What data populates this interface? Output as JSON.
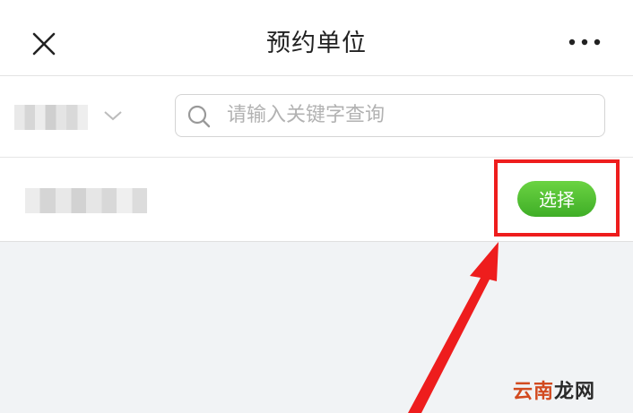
{
  "header": {
    "title": "预约单位",
    "close_icon": "close-icon",
    "more_icon": "more-icon"
  },
  "toolbar": {
    "filter_value": "",
    "filter_icon": "chevron-down-icon",
    "search": {
      "placeholder": "请输入关键字查询",
      "value": "",
      "icon": "search-icon"
    }
  },
  "list": {
    "items": [
      {
        "name": "",
        "action_label": "选择"
      }
    ]
  },
  "annotation": {
    "highlight_color": "#ee1d1d"
  },
  "watermark": {
    "text_a": "云南",
    "text_b": "龙网",
    "color_a": "#d24a1f"
  }
}
